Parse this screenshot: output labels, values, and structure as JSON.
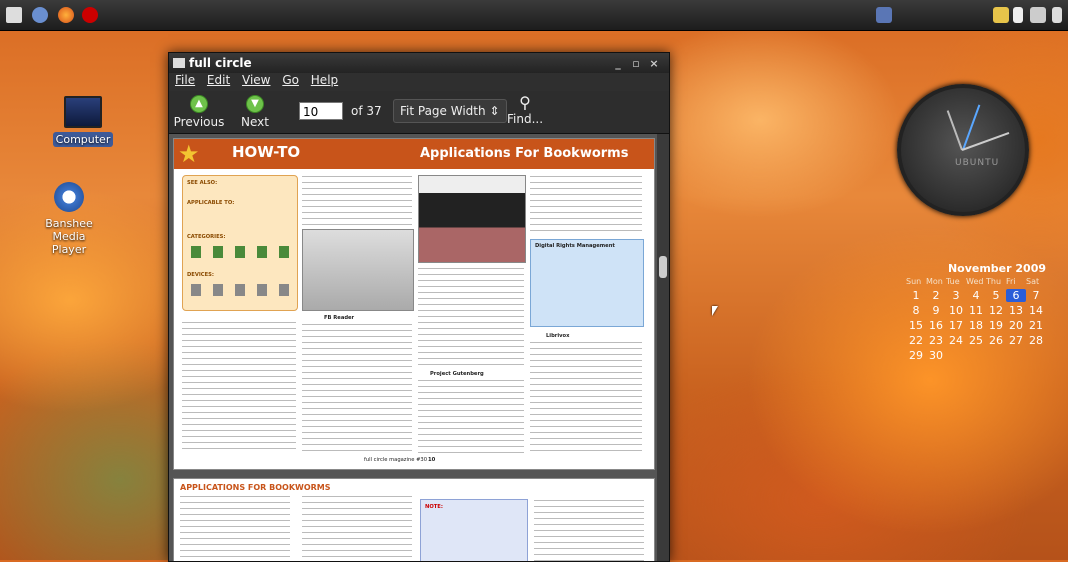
{
  "desktop": {
    "icons": [
      {
        "label": "Computer"
      },
      {
        "label": "Banshee Media Player"
      }
    ]
  },
  "window": {
    "title": "full circle",
    "menus": [
      "File",
      "Edit",
      "View",
      "Go",
      "Help"
    ],
    "toolbar": {
      "previous": "Previous",
      "next": "Next",
      "page_value": "10",
      "page_total": "of 37",
      "zoom": "Fit Page Width",
      "find": "Find..."
    }
  },
  "document": {
    "banner_left": "HOW-TO",
    "banner_right": "Applications For Bookworms",
    "see_also": "SEE ALSO:",
    "applicable_to": "APPLICABLE TO:",
    "categories": "CATEGORIES:",
    "devices": "DEVICES:",
    "col2_head": "FB Reader",
    "col3_head": "Project Gutenberg",
    "drm_head": "Digital Rights Management",
    "librivox": "Librivox",
    "footer": "full circle magazine #30",
    "page_num": "10",
    "page2_title": "APPLICATIONS FOR BOOKWORMS",
    "note": "NOTE:"
  },
  "calendar": {
    "month": "November 2009",
    "days_of_week": [
      "Sun",
      "Mon",
      "Tue",
      "Wed",
      "Thu",
      "Fri",
      "Sat"
    ],
    "days": [
      "1",
      "2",
      "3",
      "4",
      "5",
      "6",
      "7",
      "8",
      "9",
      "10",
      "11",
      "12",
      "13",
      "14",
      "15",
      "16",
      "17",
      "18",
      "19",
      "20",
      "21",
      "22",
      "23",
      "24",
      "25",
      "26",
      "27",
      "28",
      "29",
      "30"
    ],
    "today": "6"
  },
  "clock": {
    "label": "UBUNTU"
  }
}
